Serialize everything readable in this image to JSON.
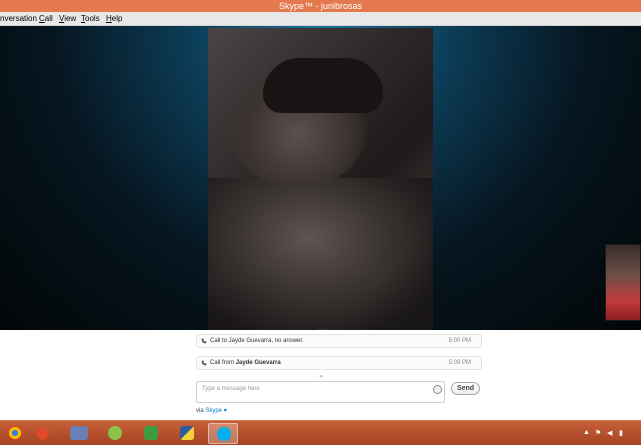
{
  "window": {
    "title": "Skype™ - junibrosas"
  },
  "menu": {
    "items": [
      {
        "label": "nversation",
        "hotkey": ""
      },
      {
        "label": "Call",
        "hotkey": "C"
      },
      {
        "label": "View",
        "hotkey": "V"
      },
      {
        "label": "Tools",
        "hotkey": "T"
      },
      {
        "label": "Help",
        "hotkey": "H"
      }
    ]
  },
  "chat": {
    "events": [
      {
        "text": "Call to Jayde Guevarra, no answer.",
        "time": "5:00 PM",
        "icon": "phone-icon"
      },
      {
        "text_prefix": "Call from ",
        "name": "Jayde Guevarra",
        "time": "5:09 PM",
        "icon": "phone-icon"
      }
    ],
    "message_placeholder": "Type a message here",
    "send_label": "Send",
    "via_label": "via",
    "via_link": "Skype",
    "via_arrow": "▾"
  },
  "taskbar": {
    "items": [
      {
        "name": "chrome-icon",
        "color": "#f0c200"
      },
      {
        "name": "app-red-icon",
        "color": "#e04a2a"
      },
      {
        "name": "php-icon",
        "color": "#6a7fb5"
      },
      {
        "name": "hs-icon",
        "color": "#8bc34a"
      },
      {
        "name": "evernote-icon",
        "color": "#3f9b3f"
      },
      {
        "name": "python-icon",
        "color": "#2f5d9b"
      },
      {
        "name": "skype-icon",
        "color": "#00aff0"
      }
    ],
    "tray": {
      "up_arrow": "▲",
      "flag": "⚑",
      "sound": "◀",
      "network": "▮"
    }
  },
  "colors": {
    "titlebar": "#e3794d",
    "taskbar": "#b4502c",
    "skype_blue": "#00aff0",
    "link": "#0a7ac5"
  }
}
